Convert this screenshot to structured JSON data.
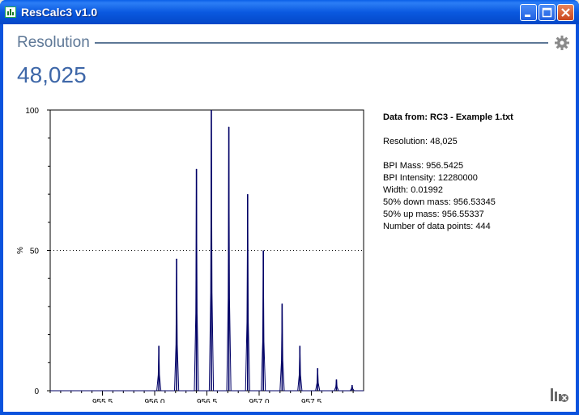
{
  "window": {
    "title": "ResCalc3 v1.0"
  },
  "section": {
    "title": "Resolution",
    "value": "48,025"
  },
  "info": {
    "header": "Data from: RC3 - Example 1.txt",
    "resolution": "Resolution: 48,025",
    "bpi_mass": "BPI Mass: 956.5425",
    "bpi_intensity": "BPI Intensity: 12280000",
    "width": "Width: 0.01992",
    "down_mass": "50% down mass: 956.53345",
    "up_mass": "50% up mass: 956.55337",
    "points": "Number of data points: 444"
  },
  "chart_data": {
    "type": "line",
    "ylabel": "%",
    "xlabel": "",
    "xlim": [
      955.0,
      958.0
    ],
    "ylim": [
      0,
      100
    ],
    "x_ticks": [
      955.5,
      956.0,
      956.5,
      957.0,
      957.5
    ],
    "x_tick_labels": [
      "955.5",
      "956.0",
      "956.5",
      "957.0",
      "957.5"
    ],
    "y_ticks": [
      0,
      50,
      100
    ],
    "y_tick_labels": [
      "0",
      "50",
      "100"
    ],
    "reference_line": {
      "y": 50,
      "style": "dotted"
    },
    "peaks": [
      {
        "x": 956.04,
        "y": 16
      },
      {
        "x": 956.21,
        "y": 47
      },
      {
        "x": 956.4,
        "y": 79
      },
      {
        "x": 956.5425,
        "y": 100
      },
      {
        "x": 956.71,
        "y": 94
      },
      {
        "x": 956.89,
        "y": 70
      },
      {
        "x": 957.04,
        "y": 50
      },
      {
        "x": 957.22,
        "y": 31
      },
      {
        "x": 957.39,
        "y": 16
      },
      {
        "x": 957.56,
        "y": 8
      },
      {
        "x": 957.74,
        "y": 4
      },
      {
        "x": 957.89,
        "y": 2
      }
    ]
  },
  "colors": {
    "titlebar": "#0a59e0",
    "accent": "#3e67a8",
    "section": "#5d7796",
    "trace": "#000066"
  },
  "icons": {
    "gear": "gear-icon",
    "corner": "chart-clear-icon",
    "app": "app-icon"
  }
}
